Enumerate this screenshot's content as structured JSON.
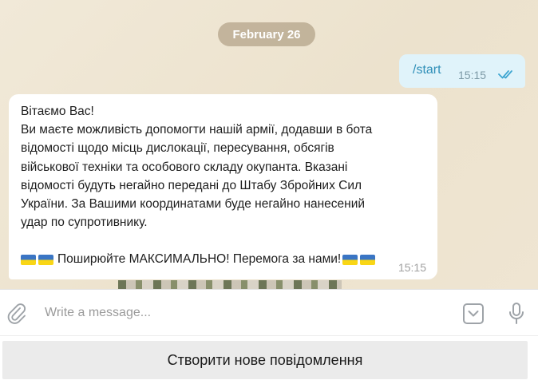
{
  "chat": {
    "date_label": "February 26",
    "outgoing": {
      "text": "/start",
      "time": "15:15",
      "status_icon": "double-check-icon",
      "status_color": "#3fa6d1"
    },
    "incoming": {
      "lines": [
        "Вітаємо Вас!",
        "Ви маєте можливість допомогти нашій армії, додавши в бота",
        "відомості щодо місць дислокації, пересування, обсягів",
        "військової техніки та особового складу окупанта. Вказані",
        "відомості будуть негайно передані до Штабу Збройних Сил",
        "України. За Вашими координатами буде негайно нанесений",
        "удар по супротивнику."
      ],
      "call_to_action": "Поширюйте МАКСИМАЛЬНО! Перемога за нами!",
      "flag_icon": "ukraine-flag-icon",
      "time": "15:15"
    }
  },
  "composer": {
    "placeholder": "Write a message...",
    "attach_icon": "paperclip-icon",
    "menu_icon": "bot-menu-icon",
    "mic_icon": "microphone-icon"
  },
  "bottom": {
    "button_label": "Створити нове повідомлення"
  },
  "colors": {
    "background": "#efe6d4",
    "outgoing_bubble": "#e0f3fa",
    "incoming_bubble": "#ffffff",
    "date_pill": "#a8967a"
  }
}
